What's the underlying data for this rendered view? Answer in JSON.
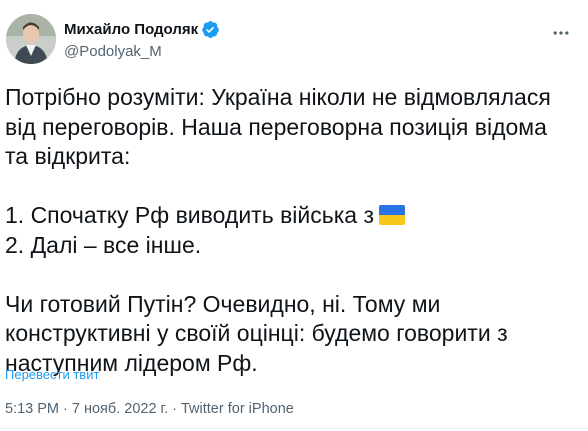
{
  "author": {
    "name": "Михайло Подоляк",
    "handle": "@Podolyak_M"
  },
  "icons": {
    "verified": "verified-badge-icon",
    "more": "more-options-icon",
    "flag": "ukraine-flag-icon"
  },
  "colors": {
    "verified": "#1d9bf0",
    "link": "#1d9bf0",
    "flag_blue": "#2b72e6",
    "flag_yellow": "#f7c81a"
  },
  "tweet": {
    "line1": "Потрібно розуміти: Україна ніколи не відмовлялася",
    "line2": "від переговорів. Наша переговорна позиція відома",
    "line3": "та відкрита:",
    "item1": "1. Спочатку Рф виводить війська з",
    "item2": "2. Далі – все інше.",
    "line4": "Чи готовий Путін? Очевидно, ні. Тому ми",
    "line5": "конструктивні у своїй оцінці: будемо говорити з",
    "line6": "наступним лідером Рф."
  },
  "translate_label": "Перевести твит",
  "meta": {
    "time": "5:13 PM",
    "sep1": " · ",
    "date": "7 нояб. 2022 г.",
    "sep2": " · ",
    "source": "Twitter for iPhone"
  }
}
